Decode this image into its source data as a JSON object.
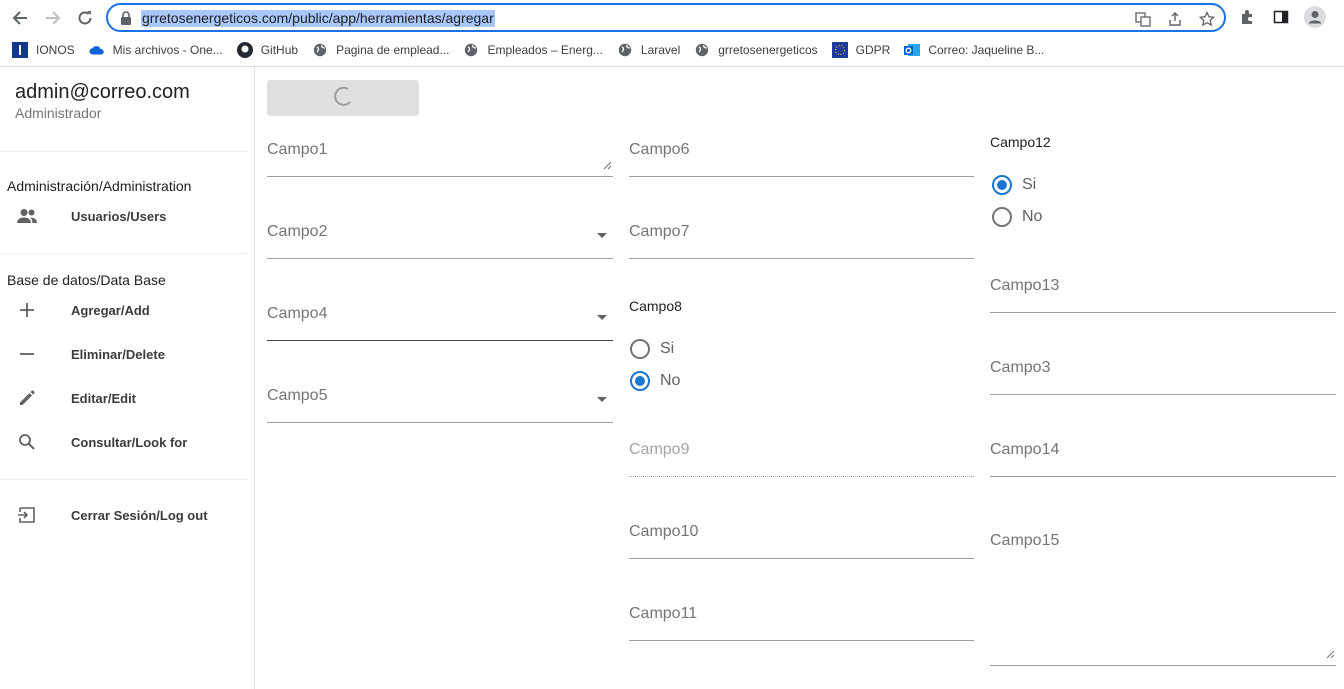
{
  "browser": {
    "url": "grretosenergeticos.com/public/app/herramientas/agregar",
    "bookmarks": [
      {
        "label": "IONOS",
        "icon": "ionos-icon"
      },
      {
        "label": "Mis archivos - One...",
        "icon": "onedrive-icon"
      },
      {
        "label": "GitHub",
        "icon": "github-icon"
      },
      {
        "label": "Pagina de emplead...",
        "icon": "globe-icon"
      },
      {
        "label": "Empleados – Energ...",
        "icon": "globe-icon"
      },
      {
        "label": "Laravel",
        "icon": "globe-icon"
      },
      {
        "label": "grretosenergeticos",
        "icon": "globe-icon"
      },
      {
        "label": "GDPR",
        "icon": "eu-flag-icon"
      },
      {
        "label": "Correo: Jaqueline B...",
        "icon": "outlook-icon"
      }
    ]
  },
  "sidebar": {
    "email": "admin@correo.com",
    "role": "Administrador",
    "section_admin": "Administración/Administration",
    "users_label": "Usuarios/Users",
    "section_db": "Base de datos/Data Base",
    "add_label": "Agregar/Add",
    "delete_label": "Eliminar/Delete",
    "edit_label": "Editar/Edit",
    "search_label": "Consultar/Look for",
    "logout_label": "Cerrar Sesión/Log out"
  },
  "form": {
    "campo1": "Campo1",
    "campo2": "Campo2",
    "campo4": "Campo4",
    "campo5": "Campo5",
    "campo6": "Campo6",
    "campo7": "Campo7",
    "campo8_title": "Campo8",
    "campo8_si": "Si",
    "campo8_no": "No",
    "campo8_selected": "No",
    "campo9": "Campo9",
    "campo10": "Campo10",
    "campo11": "Campo11",
    "campo12_title": "Campo12",
    "campo12_si": "Si",
    "campo12_no": "No",
    "campo12_selected": "Si",
    "campo13": "Campo13",
    "campo3": "Campo3",
    "campo14": "Campo14",
    "campo15": "Campo15"
  },
  "colors": {
    "accent": "#1976d2",
    "omnibox_border": "#1a73e8",
    "url_highlight": "#a8c7fa"
  }
}
